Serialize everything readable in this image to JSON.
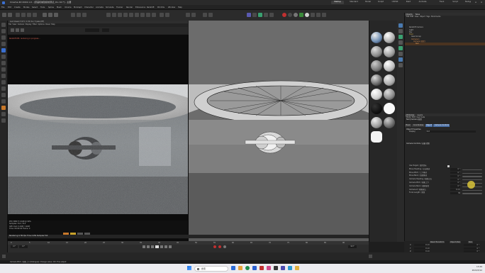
{
  "window": {
    "title": "Cinema 4D 2024.1.0 - [原画机械建模前测试_01.c4d *] - 主要",
    "tabs": [
      "Startup",
      "Standard",
      "Model",
      "Sculpt",
      "UVEdit",
      "Paint",
      "Animate",
      "Track",
      "Script",
      "Nodes"
    ],
    "active_tab": "Startup"
  },
  "menu": [
    "File",
    "Edit",
    "Create",
    "Modes",
    "Select",
    "Tools",
    "Spline",
    "Mesh",
    "Volume",
    "MoGraph",
    "Character",
    "Animate",
    "Simulate",
    "Tracker",
    "Render",
    "Extensions",
    "Redshift",
    "RS Utils",
    "Window",
    "Help"
  ],
  "viewport": {
    "left_title": "Live Viewer 3.0.5 / 1.54 ms / 3 pass (RT)",
    "left_menu": [
      "File",
      "View",
      "Camera",
      "Display",
      "Filter",
      "Options",
      "Panel",
      "Help"
    ],
    "left_notice": "Redshift IPR: rendering in progress...",
    "right_menu": [
      "View",
      "Cameras",
      "Display",
      "Options",
      "Filter",
      "Panel",
      "Redshift"
    ],
    "stats": {
      "line1": "RTX 3080 Ti 12GB @ 99%",
      "line2": "Samples: 512 / 512",
      "line3": "GPU mem 4.2GB / 12GB",
      "line4": "Time: 00:00:04   Frame: 0"
    },
    "render_line": "Rendering 0.794 fps   Time 4.28s   Samples 512"
  },
  "timeline": {
    "frame_start": "0 F",
    "frame_end": "90 F",
    "current": "0 F",
    "ticks": [
      "0",
      "5",
      "10",
      "15",
      "20",
      "25",
      "30",
      "35",
      "40",
      "45",
      "50",
      "55",
      "60",
      "65",
      "70",
      "75",
      "80",
      "85",
      "90"
    ]
  },
  "objects": {
    "tabs": [
      "Objects",
      "Takes"
    ],
    "menu": [
      "File",
      "Edit",
      "View",
      "Object",
      "Tags",
      "Bookmarks"
    ],
    "items": [
      "Redshift Camera",
      "Light",
      "Sky",
      "Floor",
      "Gear Group",
      "Camera.1",
      "Camera (固定)",
      "Null"
    ]
  },
  "attributes": {
    "tabs": [
      "Attributes",
      "Layers"
    ],
    "menu": [
      "Mode",
      "Edit",
      "User Data"
    ],
    "object_name": "Null [Camera 固定]",
    "subtabs": [
      "Basic",
      "Coordinates",
      "Object",
      "Camera Controls"
    ],
    "section1": "Object Properties",
    "display_label": "Display",
    "display_value": "Dot",
    "section2": "Camera Controls / 运镜 控制",
    "rows": [
      {
        "label": "Use Target / 使用目标",
        "value": ""
      },
      {
        "label": "Move Heading / 左右移动",
        "value": "0 °"
      },
      {
        "label": "Move Pitch / 上下移动",
        "value": "0 °"
      },
      {
        "label": "Move Bank / 旋转移动",
        "value": "0 °"
      },
      {
        "label": "Camera Heading / 相机左右",
        "value": "0 °"
      },
      {
        "label": "Camera Pitch / 相机上下",
        "value": "0 °"
      },
      {
        "label": "Camera Bank / 相机旋转",
        "value": "0 °"
      },
      {
        "label": "Camera Z / 相机前后",
        "value": "0 cm"
      },
      {
        "label": "Focal Length / 焦距",
        "value": "36"
      }
    ]
  },
  "coords": {
    "header": [
      "Reset Transform",
      "Object (Rel)",
      "Size"
    ],
    "rows": [
      [
        "X",
        "0 cm",
        "0 °"
      ],
      [
        "Y",
        "0 cm",
        "0 °"
      ],
      [
        "Z",
        "0 cm",
        "0 °"
      ]
    ]
  },
  "statusbar": "Camera Pitch / 相机上下 [Dialogue]: Change value. Ctrl: Fine adjust",
  "taskbar": {
    "search": "搜索",
    "time": "13:49",
    "date": "2024/3/12"
  },
  "colors": {
    "accent": "#3a6fd0",
    "yellow_marker": "#d9c43a",
    "highlight_orange": "#c8782a"
  }
}
